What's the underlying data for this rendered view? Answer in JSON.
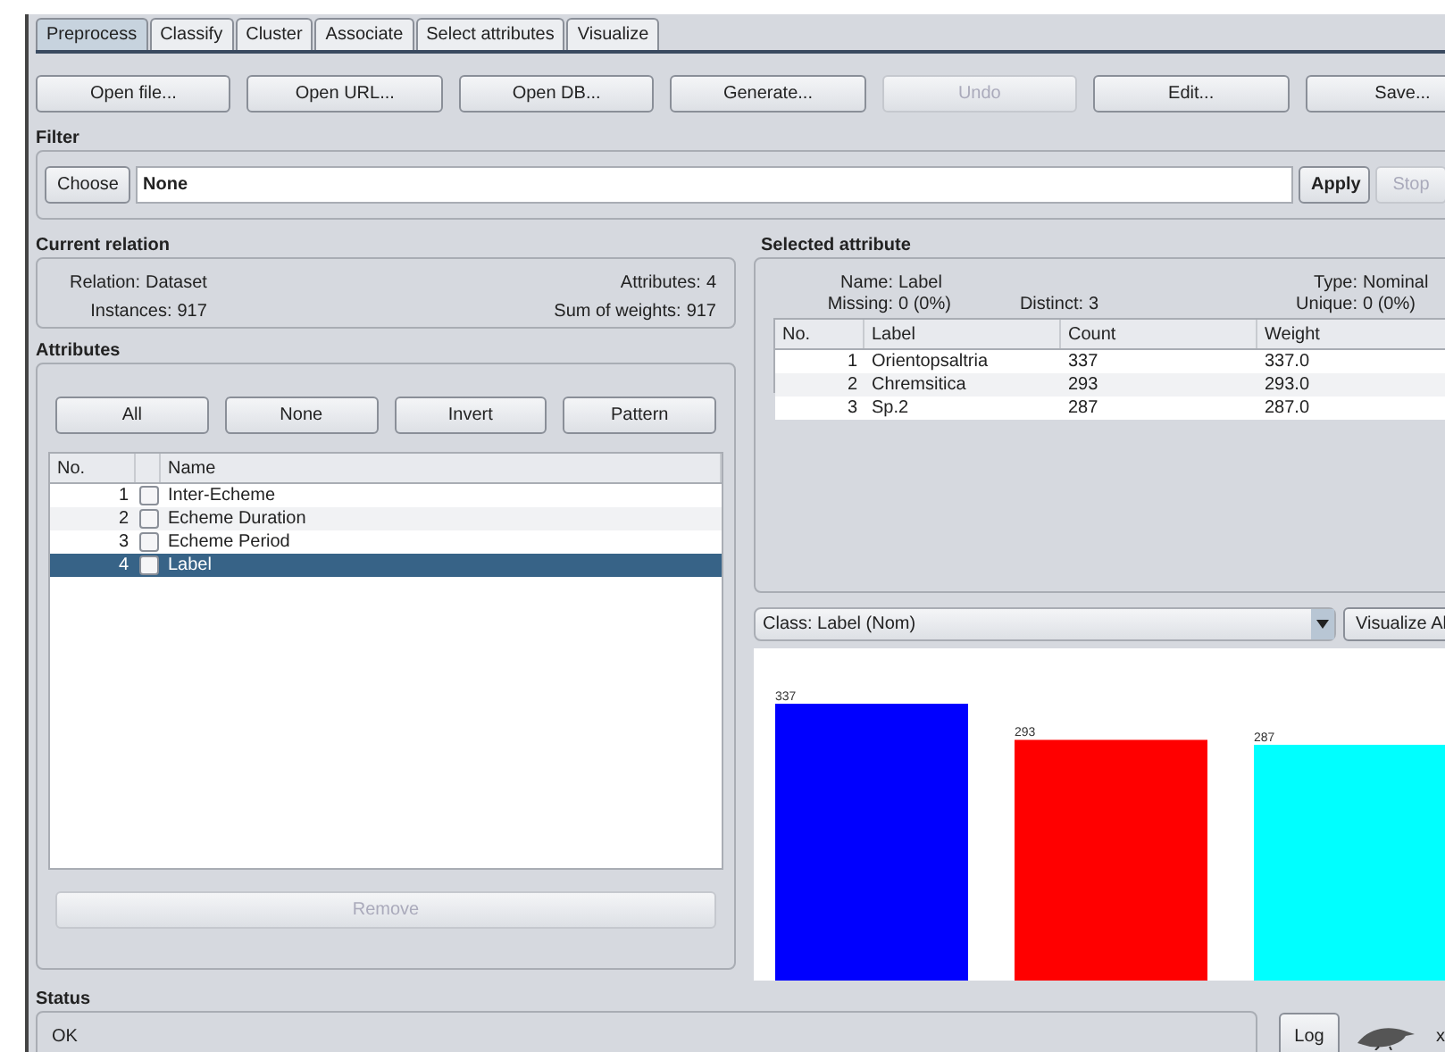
{
  "tabs": [
    {
      "label": "Preprocess",
      "selected": true
    },
    {
      "label": "Classify",
      "selected": false
    },
    {
      "label": "Cluster",
      "selected": false
    },
    {
      "label": "Associate",
      "selected": false
    },
    {
      "label": "Select attributes",
      "selected": false
    },
    {
      "label": "Visualize",
      "selected": false
    }
  ],
  "toolbar": [
    {
      "label": "Open file...",
      "disabled": false
    },
    {
      "label": "Open URL...",
      "disabled": false
    },
    {
      "label": "Open DB...",
      "disabled": false
    },
    {
      "label": "Generate...",
      "disabled": false
    },
    {
      "label": "Undo",
      "disabled": true
    },
    {
      "label": "Edit...",
      "disabled": false
    },
    {
      "label": "Save...",
      "disabled": false
    }
  ],
  "filter": {
    "title": "Filter",
    "choose": "Choose",
    "value": "None",
    "apply": {
      "label": "Apply",
      "disabled": false
    },
    "stop": {
      "label": "Stop",
      "disabled": true
    }
  },
  "current_relation": {
    "title": "Current relation",
    "left": [
      {
        "label": "Relation:",
        "value": "Dataset"
      },
      {
        "label": "Instances:",
        "value": "917"
      }
    ],
    "right": [
      {
        "label": "Attributes:",
        "value": "4"
      },
      {
        "label": "Sum of weights:",
        "value": "917"
      }
    ]
  },
  "attributes": {
    "title": "Attributes",
    "buttons": [
      "All",
      "None",
      "Invert",
      "Pattern"
    ],
    "columns": [
      "No.",
      "Name"
    ],
    "rows": [
      {
        "no": "1",
        "name": "Inter-Echeme",
        "checked": false,
        "selected": false
      },
      {
        "no": "2",
        "name": "Echeme Duration",
        "checked": false,
        "selected": false
      },
      {
        "no": "3",
        "name": "Echeme Period",
        "checked": false,
        "selected": false
      },
      {
        "no": "4",
        "name": "Label",
        "checked": false,
        "selected": true
      }
    ],
    "remove": {
      "label": "Remove",
      "disabled": true
    }
  },
  "selected_attribute": {
    "title": "Selected attribute",
    "info": [
      {
        "label": "Name:",
        "value": "Label"
      },
      {
        "label": "Type:",
        "value": "Nominal"
      },
      {
        "label": "Missing:",
        "value": "0 (0%)"
      },
      {
        "label": "Distinct:",
        "value": "3"
      },
      {
        "label": "Unique:",
        "value": "0 (0%)"
      }
    ],
    "columns": [
      "No.",
      "Label",
      "Count",
      "Weight"
    ],
    "rows": [
      [
        "1",
        "Orientopsaltria",
        "337",
        "337.0"
      ],
      [
        "2",
        "Chremsitica",
        "293",
        "293.0"
      ],
      [
        "3",
        "Sp.2",
        "287",
        "287.0"
      ]
    ]
  },
  "class_select": {
    "value": "Class: Label (Nom)",
    "visualize": "Visualize Al"
  },
  "histogram": {
    "chart_data": {
      "type": "bar",
      "values": [
        337,
        293,
        287
      ],
      "colors": [
        "#0000ff",
        "#ff0000",
        "#00ffff"
      ],
      "data_labels": true
    }
  },
  "status": {
    "title": "Status",
    "message": "OK",
    "log": "Log",
    "count": "x"
  }
}
